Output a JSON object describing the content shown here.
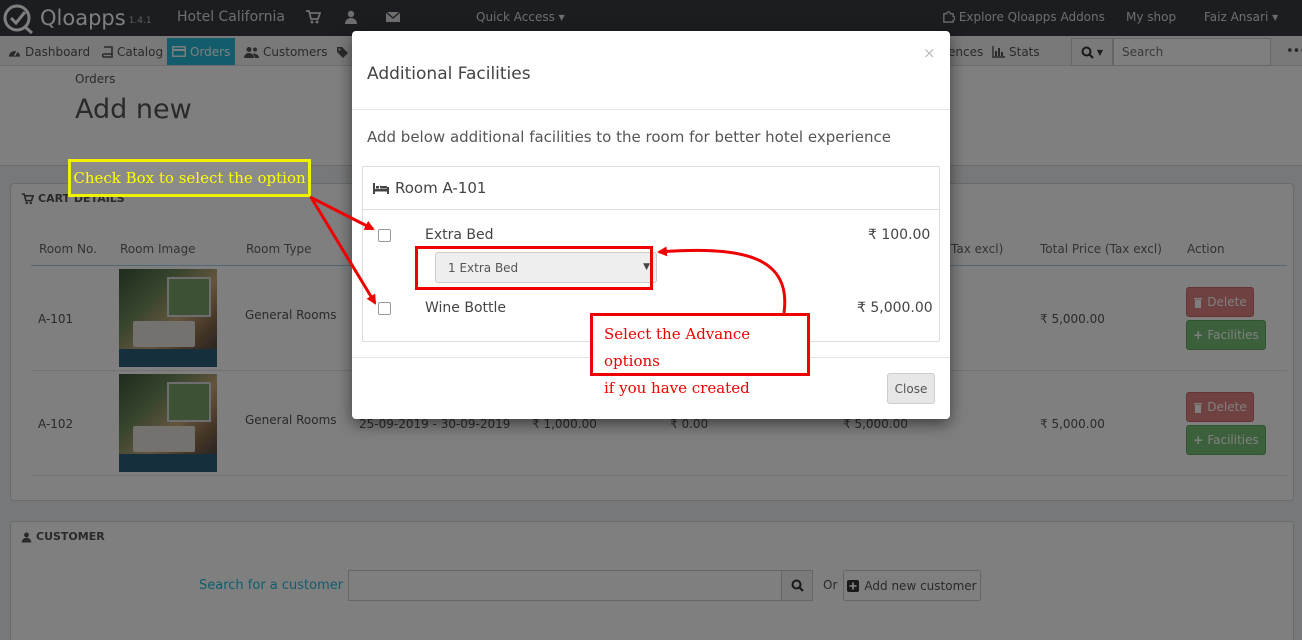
{
  "header": {
    "brand": "Qloapps",
    "version": "1.4.1",
    "shop_name": "Hotel California",
    "quick_access": "Quick Access",
    "explore": "Explore Qloapps Addons",
    "my_shop": "My shop",
    "user": "Faiz Ansari"
  },
  "nav": {
    "items": [
      "Dashboard",
      "Catalog",
      "Orders",
      "Customers"
    ],
    "partial_right": "ences",
    "stats": "Stats",
    "search_placeholder": "Search"
  },
  "page": {
    "breadcrumb": "Orders",
    "title": "Add new"
  },
  "cart": {
    "heading": "CART DETAILS",
    "headers": [
      "Room No.",
      "Room Image",
      "Room Type",
      "Tax excl)",
      "Total Price (Tax excl)",
      "Action"
    ],
    "rows": [
      {
        "room_no": "A-101",
        "room_type": "General Rooms",
        "total": "₹ 5,000.00",
        "delete": "Delete",
        "facilities": "Facilities"
      },
      {
        "room_no": "A-102",
        "room_type": "General Rooms",
        "dates": "25-09-2019 - 30-09-2019",
        "price": "₹ 1,000.00",
        "tax": "₹ 0.00",
        "sub": "₹ 5,000.00",
        "total": "₹ 5,000.00",
        "delete": "Delete",
        "facilities": "Facilities"
      }
    ]
  },
  "customer": {
    "heading": "CUSTOMER",
    "search_label": "Search for a customer",
    "or": "Or",
    "add_label": "Add new customer"
  },
  "modal": {
    "title": "Additional Facilities",
    "close_x": "×",
    "description": "Add below additional facilities to the room for better hotel experience",
    "room": "Room A-101",
    "facilities": [
      {
        "name": "Extra Bed",
        "price": "₹ 100.00",
        "option": "1 Extra Bed"
      },
      {
        "name": "Wine Bottle",
        "price": "₹ 5,000.00"
      }
    ],
    "close_button": "Close"
  },
  "annotations": {
    "checkbox_note": "Check Box to select the option",
    "advance_line1": "Select the Advance options",
    "advance_line2": "if you have created"
  }
}
